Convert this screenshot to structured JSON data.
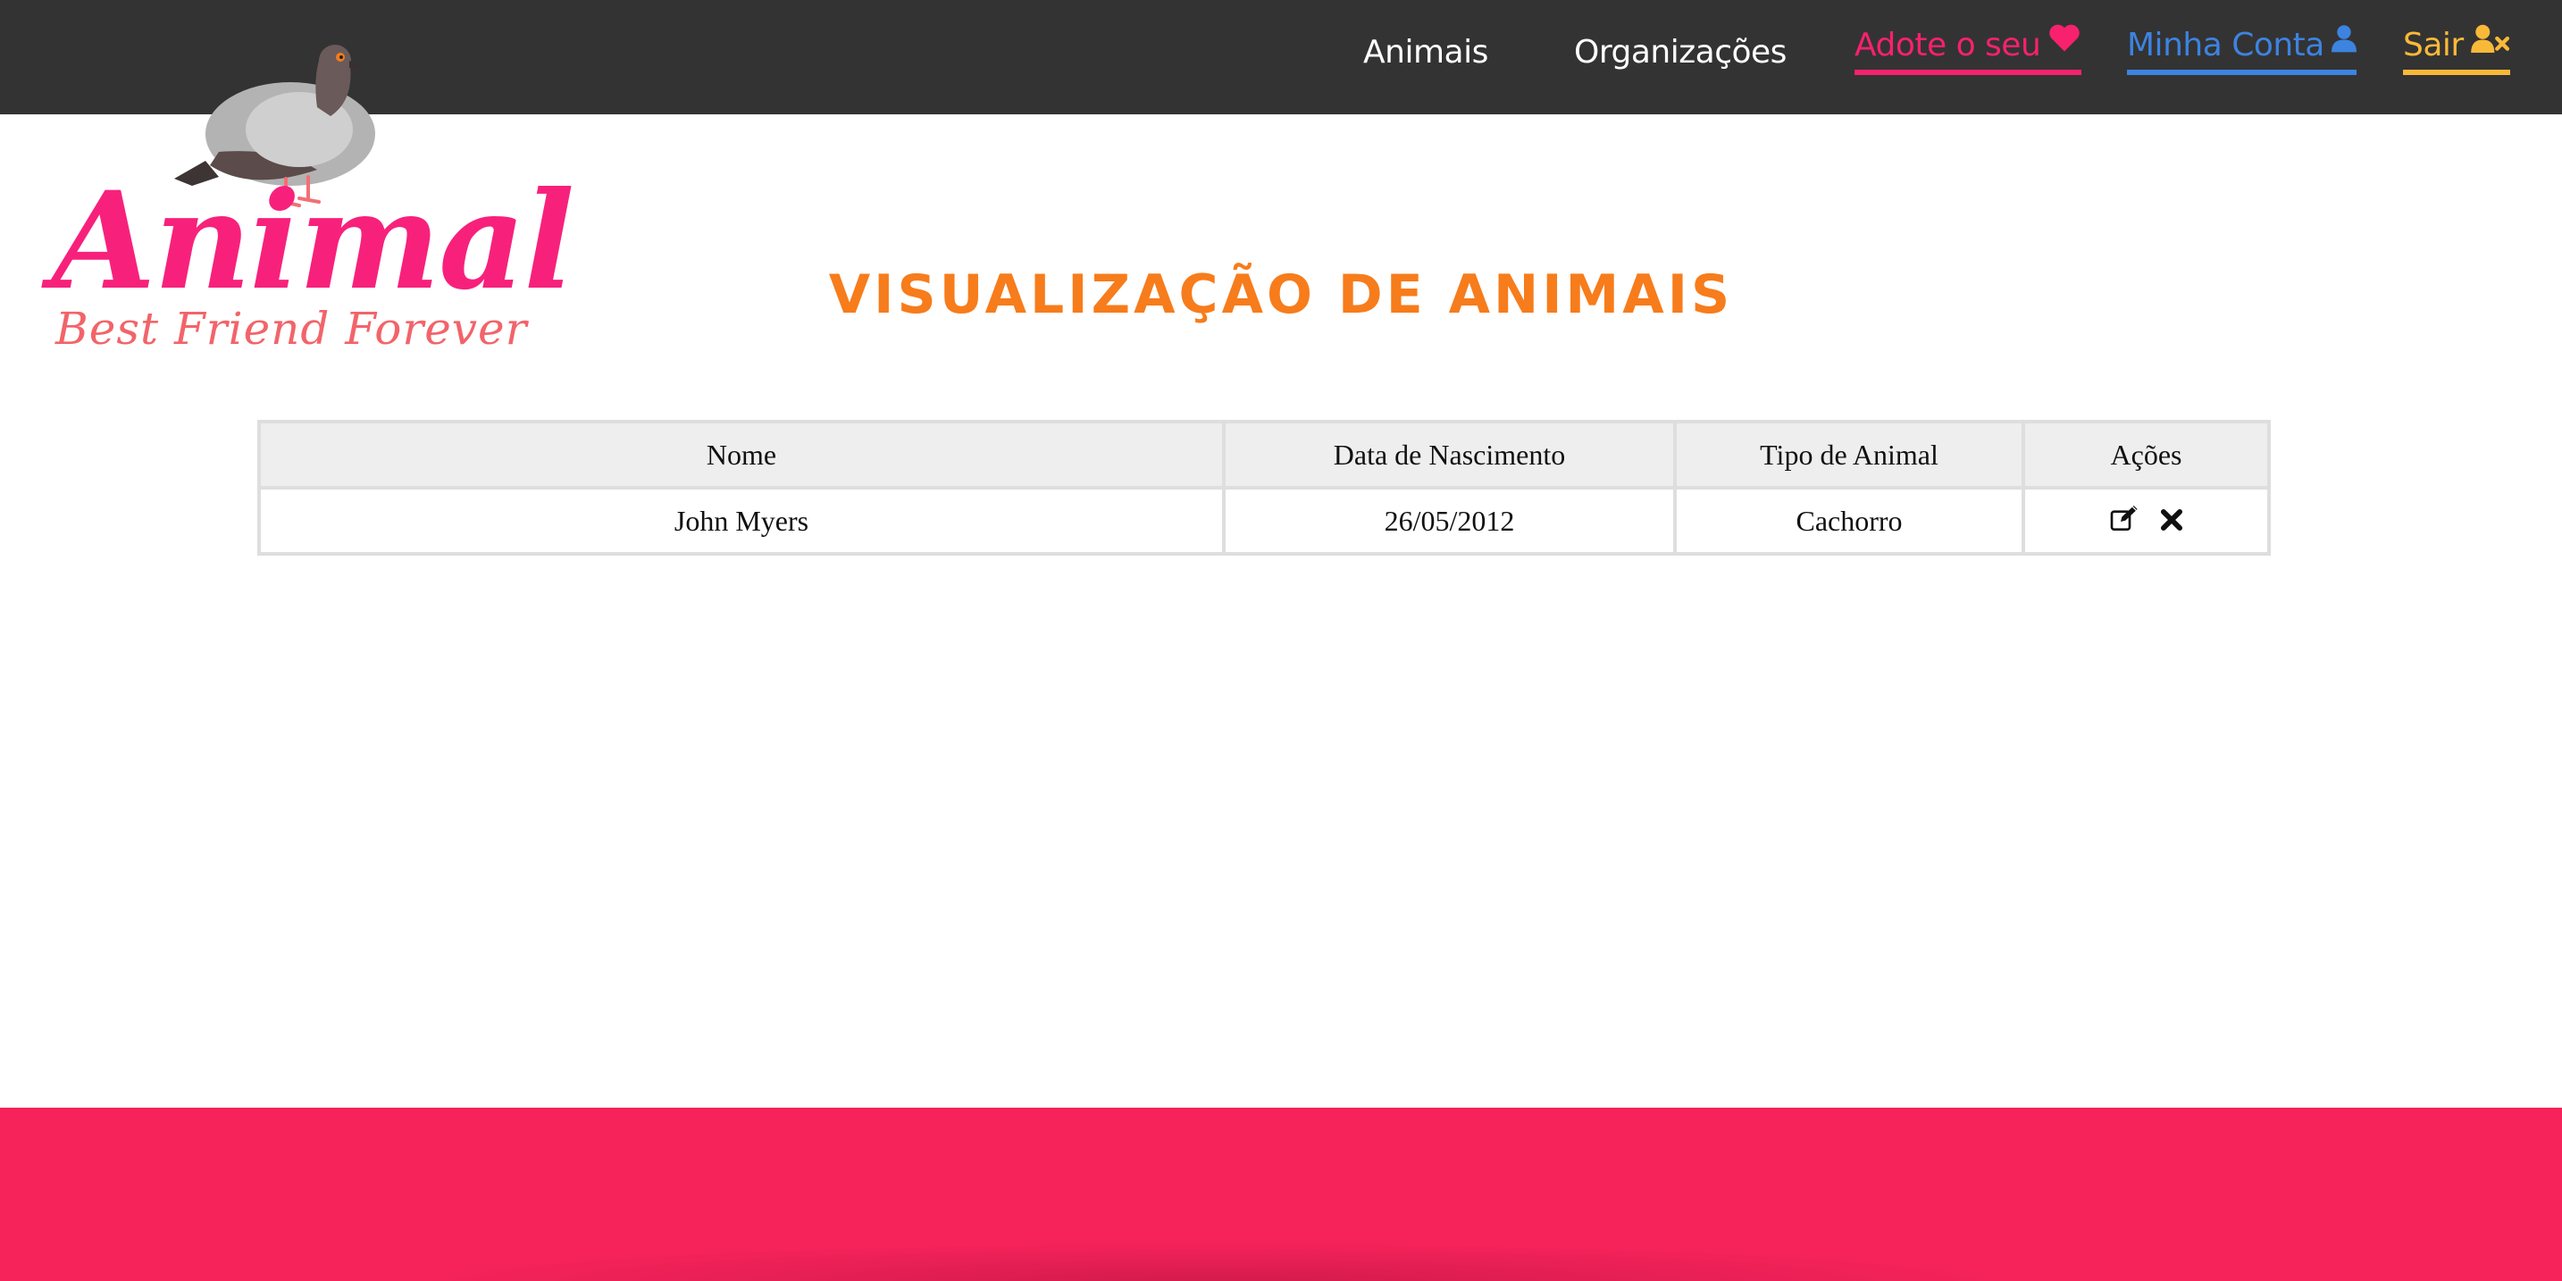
{
  "nav": {
    "items": [
      {
        "label": "Animais",
        "color": "#ffffff"
      },
      {
        "label": "Organizações",
        "color": "#ffffff"
      },
      {
        "label": "Adote o seu",
        "color": "#f7216d",
        "icon": "heart-icon"
      },
      {
        "label": "Minha Conta",
        "color": "#3d83e0",
        "icon": "user-icon"
      },
      {
        "label": "Sair",
        "color": "#f9b938",
        "icon": "user-times-icon"
      }
    ]
  },
  "logo": {
    "word": "Animal",
    "tagline": "Best Friend Forever",
    "icon": "pigeon-icon"
  },
  "page": {
    "title": "VISUALIZAÇÃO DE ANIMAIS"
  },
  "table": {
    "headers": [
      "Nome",
      "Data de Nascimento",
      "Tipo de Animal",
      "Ações"
    ],
    "rows": [
      {
        "name": "John Myers",
        "birth_date": "26/05/2012",
        "type": "Cachorro",
        "actions": [
          "edit-icon",
          "delete-icon"
        ]
      }
    ]
  },
  "colors": {
    "topbar": "#333333",
    "title": "#f77c1b",
    "footer": "#f5235a",
    "logo_pink": "#f7217b"
  }
}
